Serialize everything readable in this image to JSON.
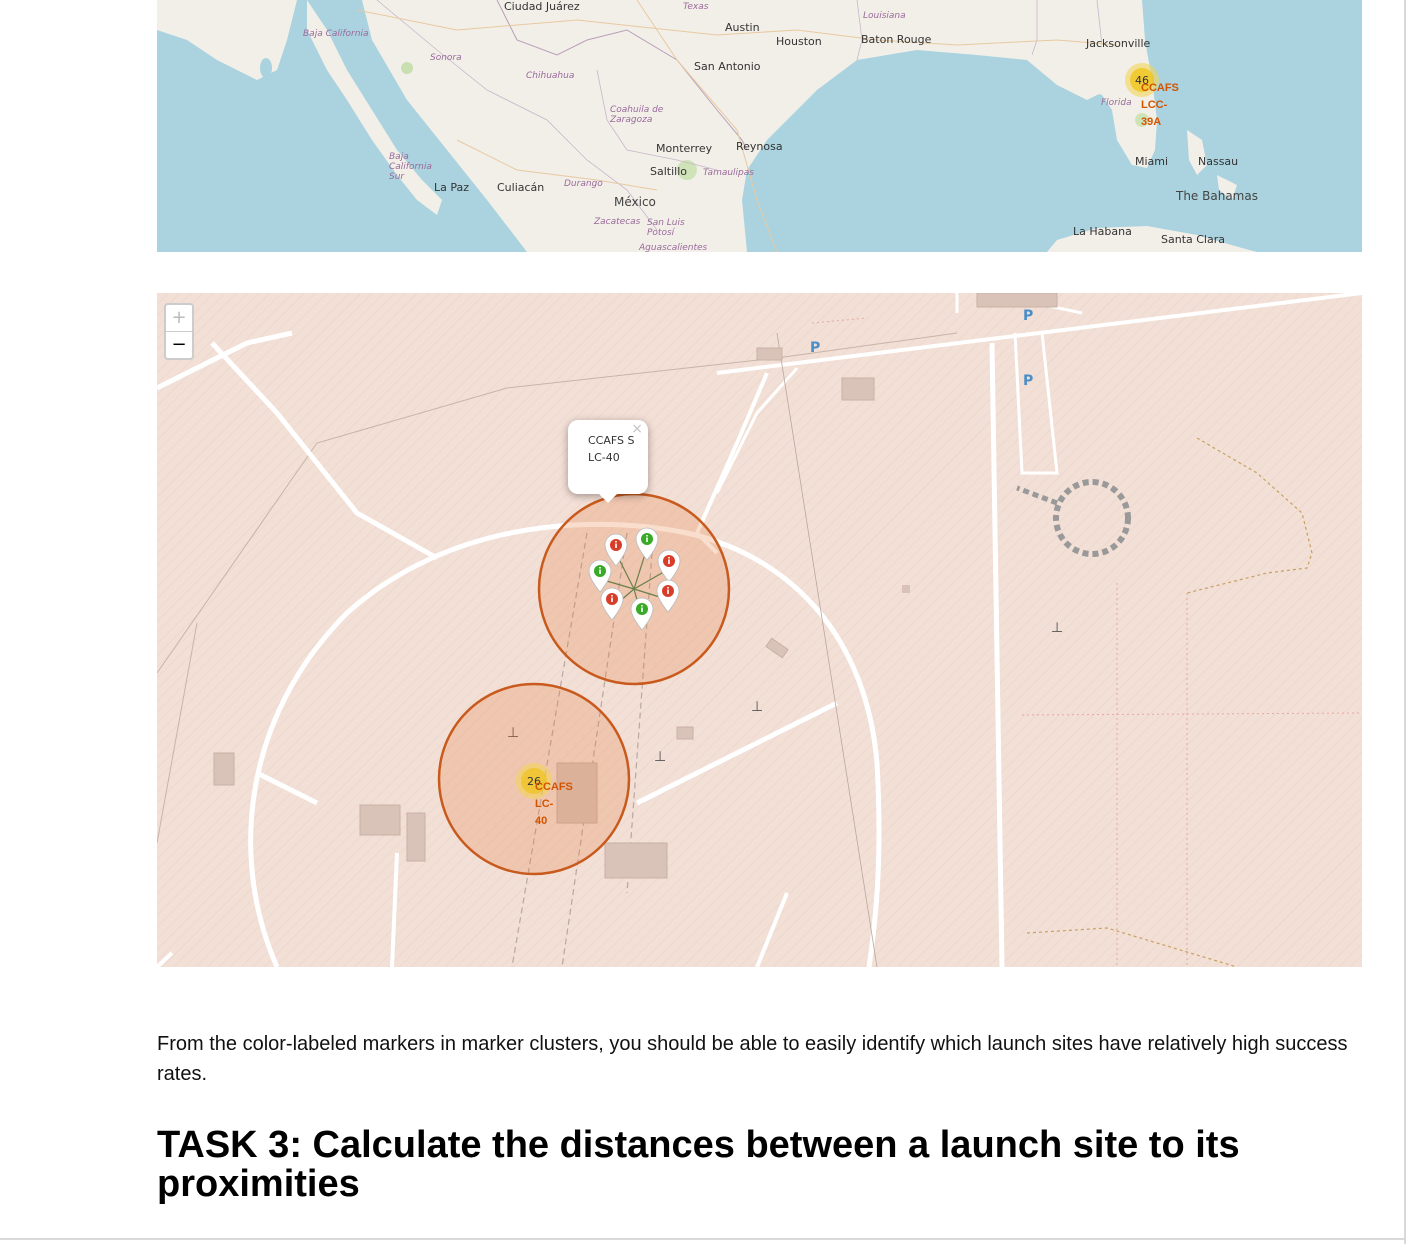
{
  "overview_map": {
    "labels": {
      "ciudad_juarez": "Ciudad Juárez",
      "texas": "Texas",
      "louisiana": "Louisiana",
      "austin": "Austin",
      "houston": "Houston",
      "baton_rouge": "Baton Rouge",
      "jacksonville": "Jacksonville",
      "baja_california": "Baja California",
      "sonora": "Sonora",
      "chihuahua": "Chihuahua",
      "san_antonio": "San Antonio",
      "coahuila": "Coahuila de Zaragoza",
      "florida": "Florida",
      "monterrey": "Monterrey",
      "reynosa": "Reynosa",
      "baja_california_sur": "Baja California Sur",
      "saltillo": "Saltillo",
      "tamaulipas": "Tamaulipas",
      "miami": "Miami",
      "nassau": "Nassau",
      "la_paz": "La Paz",
      "culiacan": "Culiacán",
      "durango": "Durango",
      "mexico": "México",
      "the_bahamas": "The Bahamas",
      "zacatecas": "Zacatecas",
      "san_luis_potosi": "San Luis Potosí",
      "la_habana": "La Habana",
      "santa_clara": "Santa Clara",
      "aguascalientes": "Aguascalientes"
    },
    "cluster_count": "46",
    "site_label": "CCAFS\nLCC-\n39A"
  },
  "detail_map": {
    "zoom_in": "+",
    "zoom_out": "−",
    "parking": [
      "P",
      "P",
      "P"
    ],
    "popup_text": "CCAFS SLC-40",
    "popup_close": "×",
    "cluster_count": "26",
    "site_label": "CCAFS\nLC-\n40",
    "markers": [
      {
        "status": "failure",
        "color": "#d63e2a"
      },
      {
        "status": "success",
        "color": "#38aa26"
      },
      {
        "status": "failure",
        "color": "#d63e2a"
      },
      {
        "status": "success",
        "color": "#38aa26"
      },
      {
        "status": "failure",
        "color": "#d63e2a"
      },
      {
        "status": "failure",
        "color": "#d63e2a"
      },
      {
        "status": "success",
        "color": "#38aa26"
      }
    ]
  },
  "text": {
    "paragraph": "From the color-labeled markers in marker clusters, you should be able to easily identify which launch sites have relatively high success rates.",
    "heading": "TASK 3: Calculate the distances between a launch site to its proximities"
  }
}
